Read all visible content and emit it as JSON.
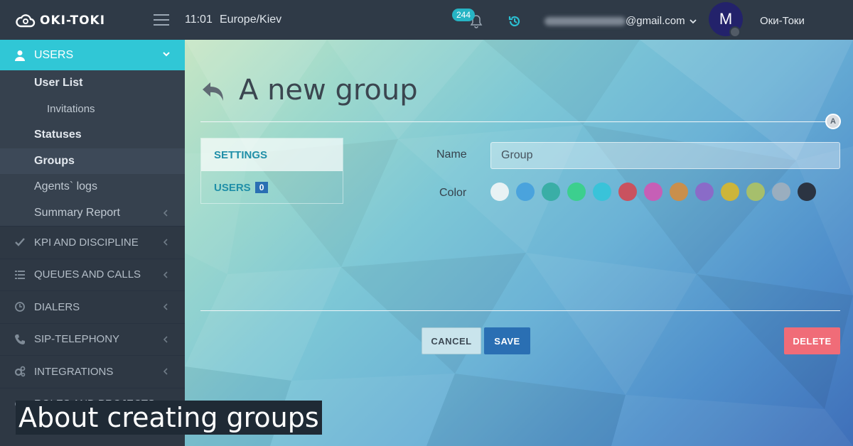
{
  "header": {
    "logo_text": "OKI-TOKI",
    "time": "11:01",
    "timezone": "Europe/Kiev",
    "notifications_count": "244",
    "email_suffix": "@gmail.com",
    "avatar_letter": "M",
    "company": "Оки-Токи"
  },
  "sidebar": {
    "section": "USERS",
    "sub_items": [
      {
        "label": "User List"
      },
      {
        "label": "Invitations"
      },
      {
        "label": "Statuses"
      },
      {
        "label": "Groups"
      },
      {
        "label": "Agents` logs"
      },
      {
        "label": "Summary Report"
      }
    ],
    "items": [
      {
        "label": "KPI AND DISCIPLINE",
        "icon": "check-icon"
      },
      {
        "label": "QUEUES AND CALLS",
        "icon": "list-icon"
      },
      {
        "label": "DIALERS",
        "icon": "clock-icon"
      },
      {
        "label": "SIP-TELEPHONY",
        "icon": "phone-icon"
      },
      {
        "label": "INTEGRATIONS",
        "icon": "gears-icon"
      },
      {
        "label": "ROLES AND PROJECTS",
        "icon": "toggle-icon"
      }
    ]
  },
  "main": {
    "title": "A new group",
    "badge": "A",
    "tabs": [
      {
        "label": "SETTINGS"
      },
      {
        "label": "USERS",
        "count": "0"
      }
    ],
    "form": {
      "name_label": "Name",
      "name_value": "Group",
      "color_label": "Color",
      "colors": [
        "#e8f2f4",
        "#4aa3dd",
        "#3aaea6",
        "#3ccf8e",
        "#39c3d9",
        "#c9525f",
        "#c65fb6",
        "#c98f4c",
        "#8a6bc8",
        "#cdb53a",
        "#a6bf6c",
        "#9aaebf",
        "#2b3442"
      ]
    },
    "buttons": {
      "cancel": "CANCEL",
      "save": "SAVE",
      "delete": "DELETE"
    }
  },
  "caption": "About creating groups"
}
